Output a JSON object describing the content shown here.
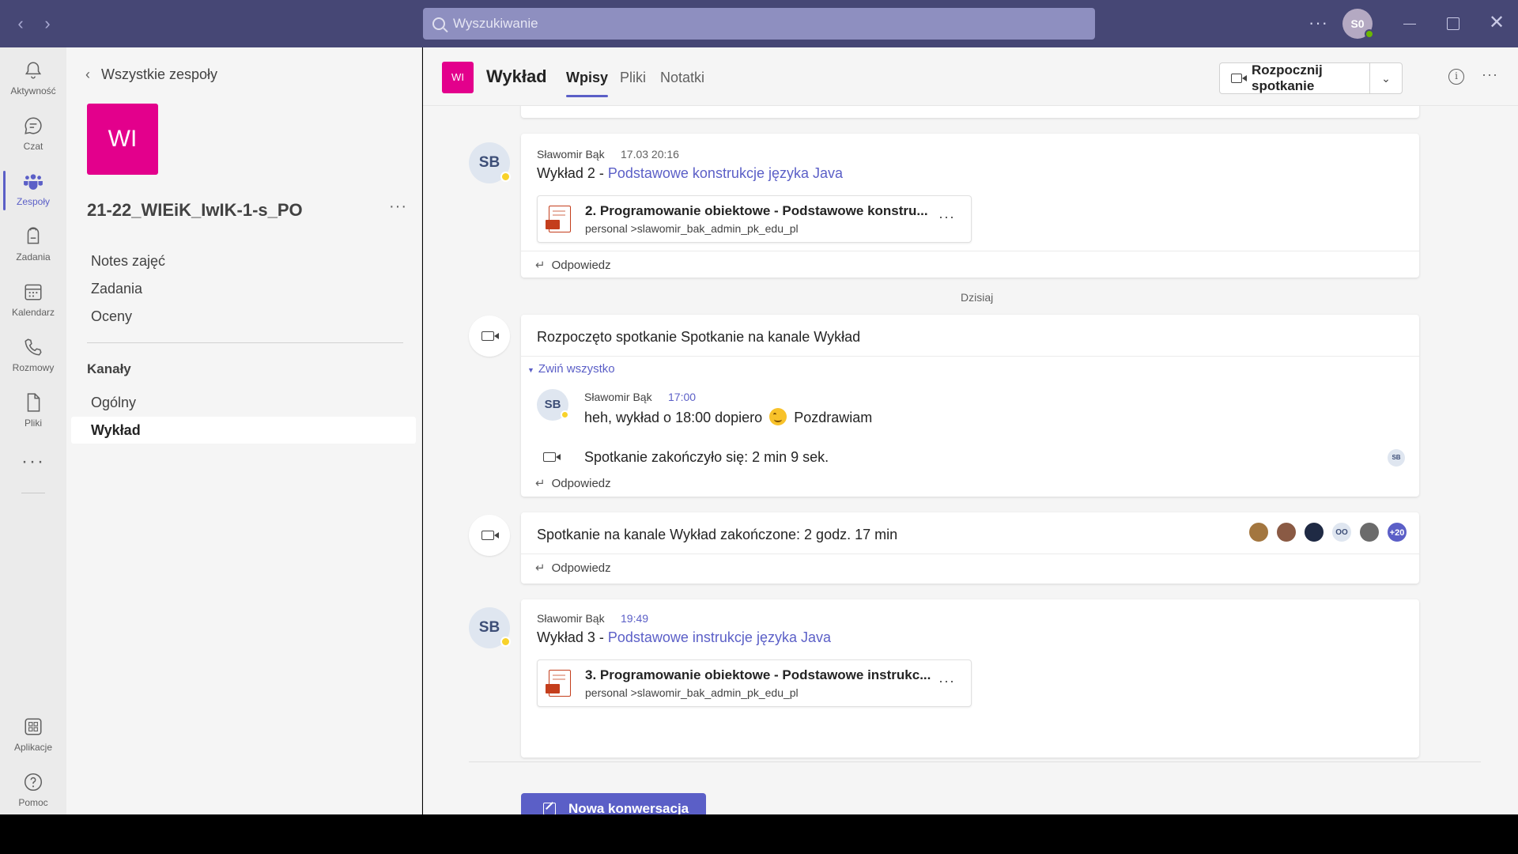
{
  "titlebar": {
    "search_placeholder": "Wyszukiwanie",
    "avatar_initials": "S0",
    "nav_back": "‹",
    "nav_forward": "›",
    "more": "···"
  },
  "rail": {
    "items": [
      {
        "label": "Aktywność",
        "icon": "bell-icon"
      },
      {
        "label": "Czat",
        "icon": "chat-icon"
      },
      {
        "label": "Zespoły",
        "icon": "teams-icon"
      },
      {
        "label": "Zadania",
        "icon": "assignments-icon"
      },
      {
        "label": "Kalendarz",
        "icon": "calendar-icon"
      },
      {
        "label": "Rozmowy",
        "icon": "phone-icon"
      },
      {
        "label": "Pliki",
        "icon": "file-icon"
      }
    ],
    "more": "···",
    "bottom_items": [
      {
        "label": "Aplikacje",
        "icon": "apps-icon"
      },
      {
        "label": "Pomoc",
        "icon": "help-icon"
      }
    ]
  },
  "team_panel": {
    "back_label": "Wszystkie zespoły",
    "team_logo": "WI",
    "team_name": "21-22_WIEiK_IwIK-1-s_PO",
    "more": "···",
    "links": [
      "Notes zajęć",
      "Zadania",
      "Oceny"
    ],
    "channels_header": "Kanały",
    "channels": [
      "Ogólny",
      "Wykład"
    ]
  },
  "channel_header": {
    "logo": "WI",
    "title": "Wykład",
    "tabs": [
      "Wpisy",
      "Pliki",
      "Notatki"
    ],
    "meet_button": "Rozpocznij spotkanie",
    "more": "···"
  },
  "feed": {
    "post1": {
      "initials": "SB",
      "author": "Sławomir Bąk",
      "time": "17.03 20:16",
      "text_prefix": "Wykład 2 - ",
      "text_link": "Podstawowe konstrukcje języka Java",
      "file_title": "2. Programowanie obiektowe - Podstawowe konstru...",
      "file_path": "personal >slawomir_bak_admin_pk_edu_pl",
      "reply": "Odpowiedz"
    },
    "day_divider": "Dzisiaj",
    "meeting1": {
      "title": "Rozpoczęto spotkanie Spotkanie na kanale Wykład",
      "collapse": "Zwiń wszystko",
      "reply_initials": "SB",
      "reply_author": "Sławomir Bąk",
      "reply_time": "17:00",
      "reply_text_a": "heh, wykład o 18:00 dopiero",
      "reply_text_b": "Pozdrawiam",
      "ended": "Spotkanie zakończyło się: 2 min 9 sek.",
      "ended_badge": "SB",
      "reply": "Odpowiedz"
    },
    "meeting2": {
      "title": "Spotkanie na kanale Wykład zakończone: 2 godz. 17 min",
      "participants_text": [
        "",
        "",
        "",
        "OO",
        "",
        "+20"
      ],
      "reply": "Odpowiedz"
    },
    "post2": {
      "initials": "SB",
      "author": "Sławomir Bąk",
      "time": "19:49",
      "text_prefix": "Wykład 3 - ",
      "text_link": "Podstawowe instrukcje języka Java",
      "file_title": "3. Programowanie obiektowe - Podstawowe instrukc...",
      "file_path": "personal >slawomir_bak_admin_pk_edu_pl"
    }
  },
  "compose": {
    "new_conversation": "Nowa konwersacja"
  },
  "colors": {
    "brand": "#5b5fc7",
    "titlebar": "#464775",
    "team_logo": "#e3008c"
  }
}
